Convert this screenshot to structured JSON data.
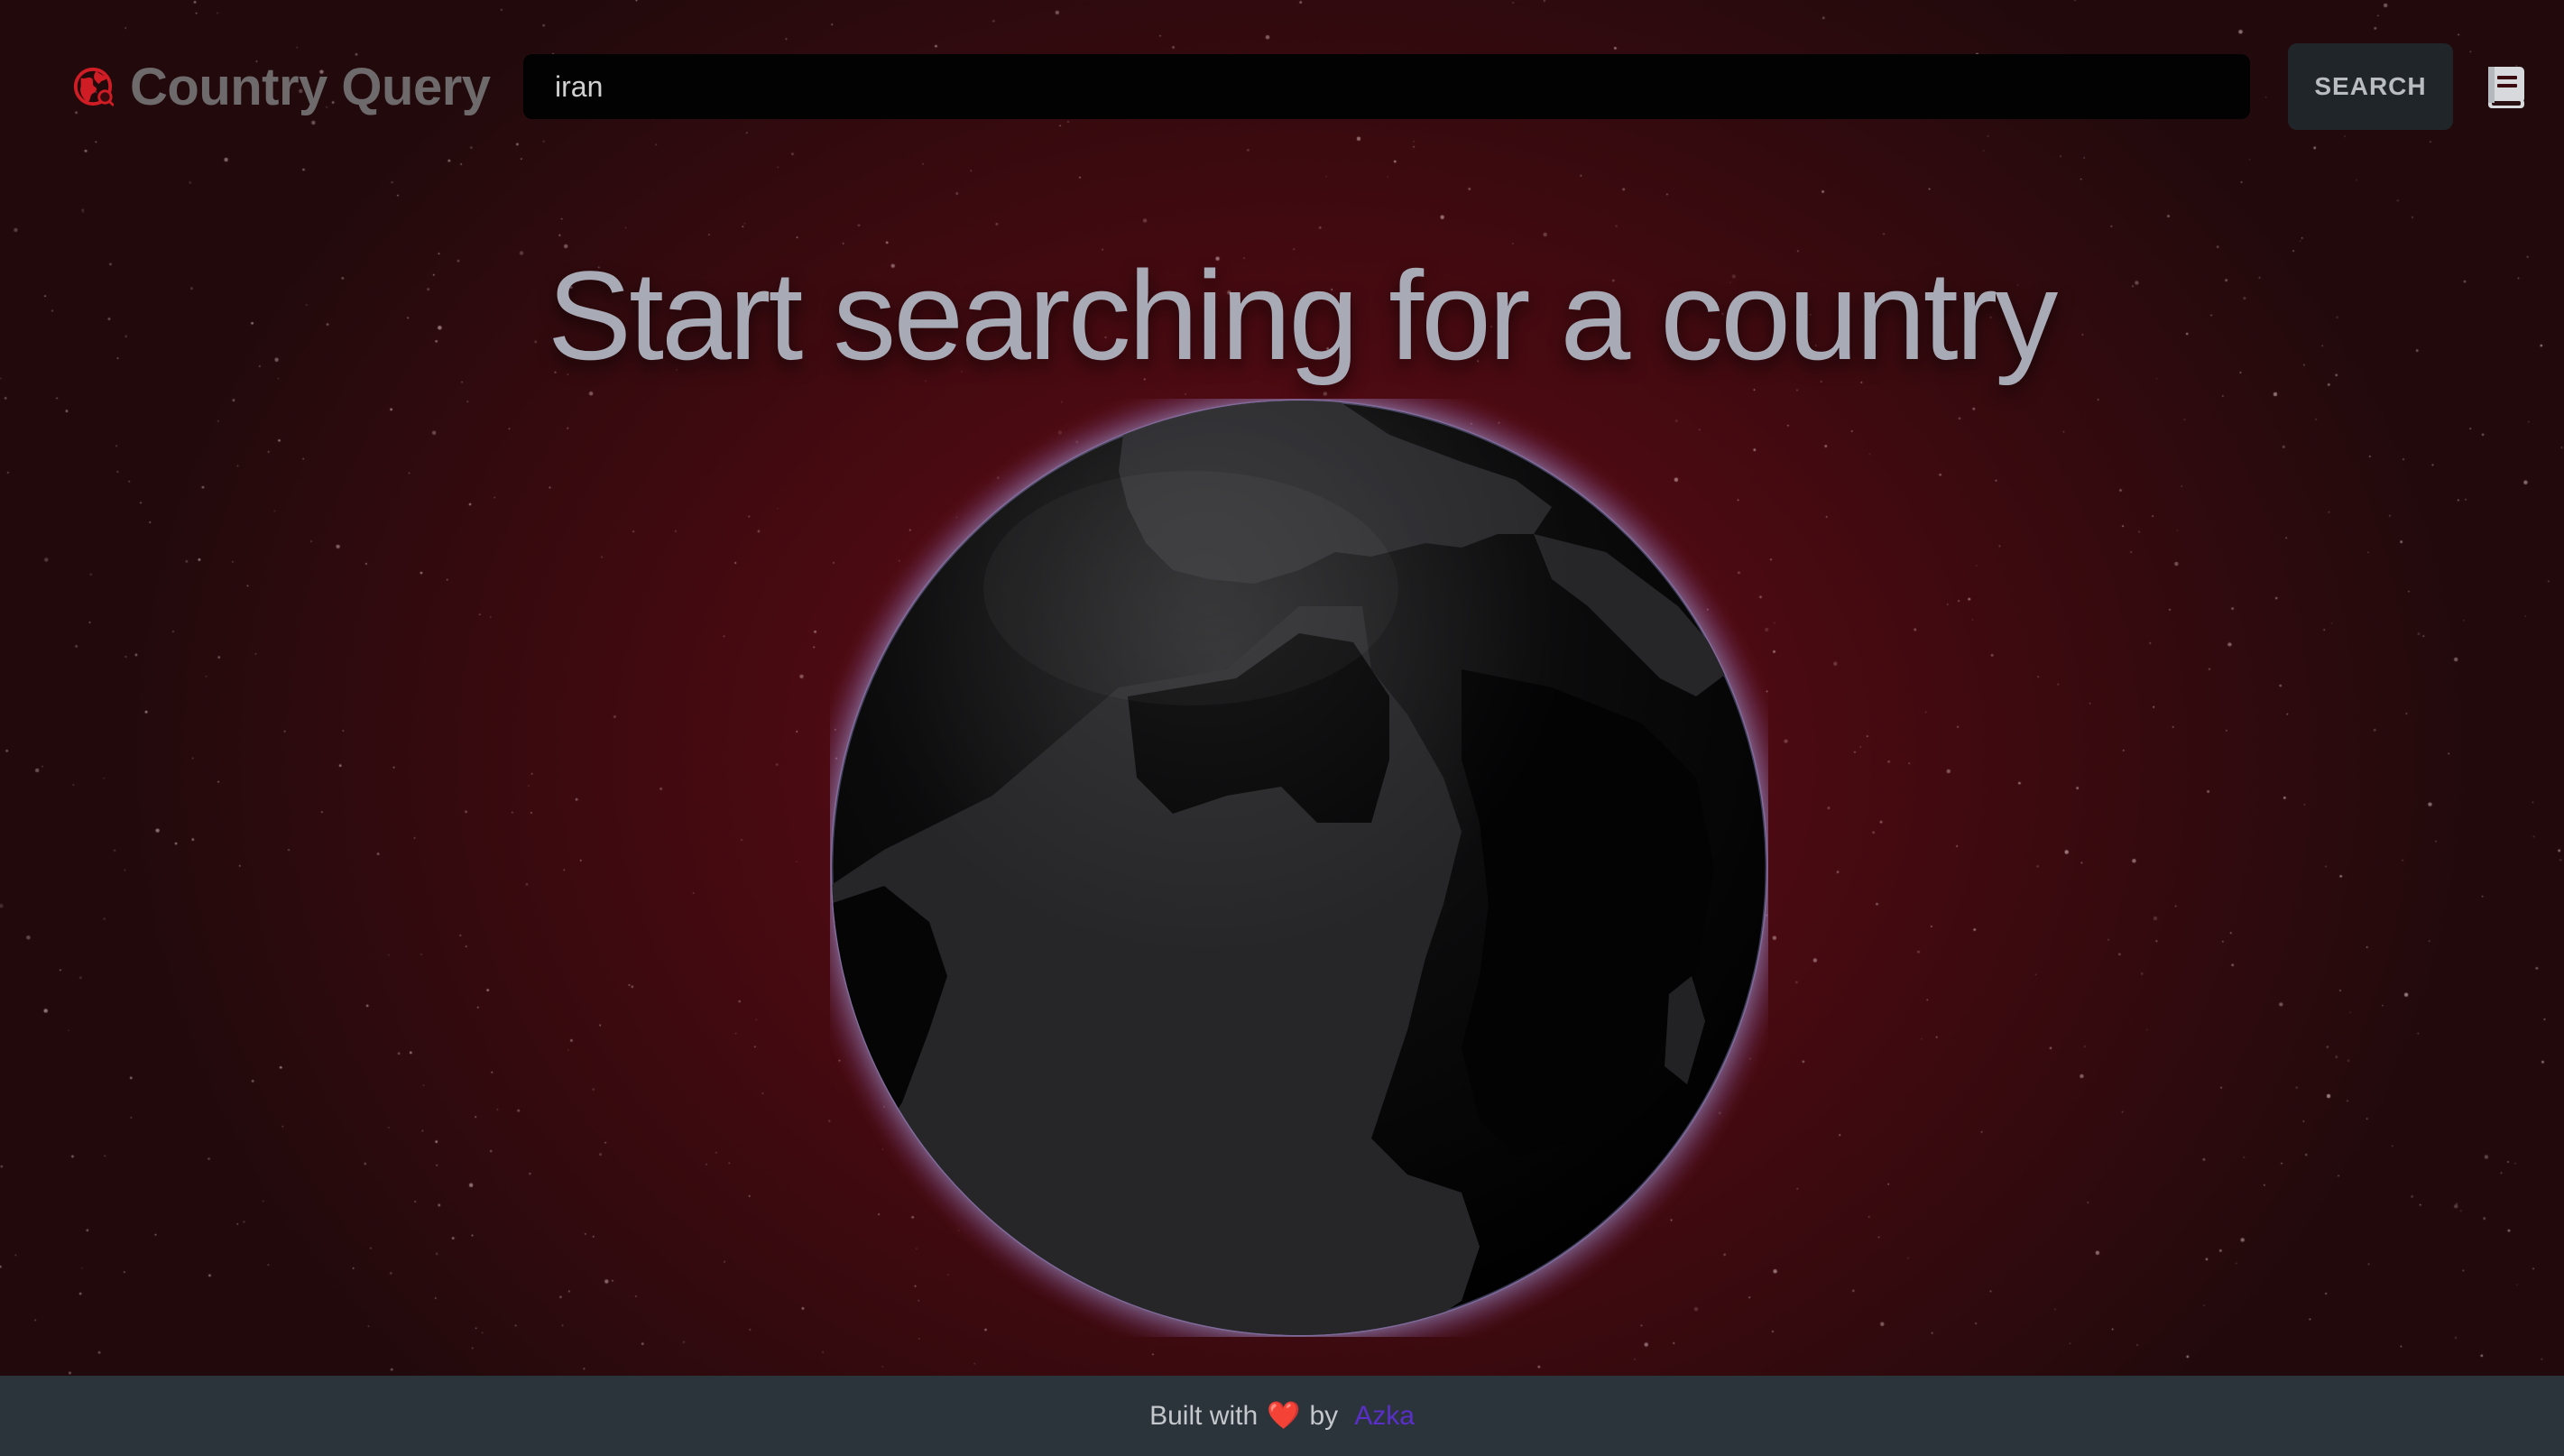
{
  "header": {
    "brand_title": "Country Query",
    "search": {
      "value": "iran",
      "placeholder": ""
    },
    "search_button_label": "SEARCH",
    "icons": {
      "brand": "globe-icon",
      "docs": "book-icon"
    }
  },
  "main": {
    "headline": "Start searching for a country"
  },
  "footer": {
    "built_with": "Built with",
    "heart": "❤️",
    "by": "by",
    "author": "Azka"
  },
  "colors": {
    "accent": "#e02424",
    "background": "#4f0a12",
    "footer_bg": "#2c343b",
    "author_link": "#5a2fc9",
    "headline": "#a8abb6"
  }
}
